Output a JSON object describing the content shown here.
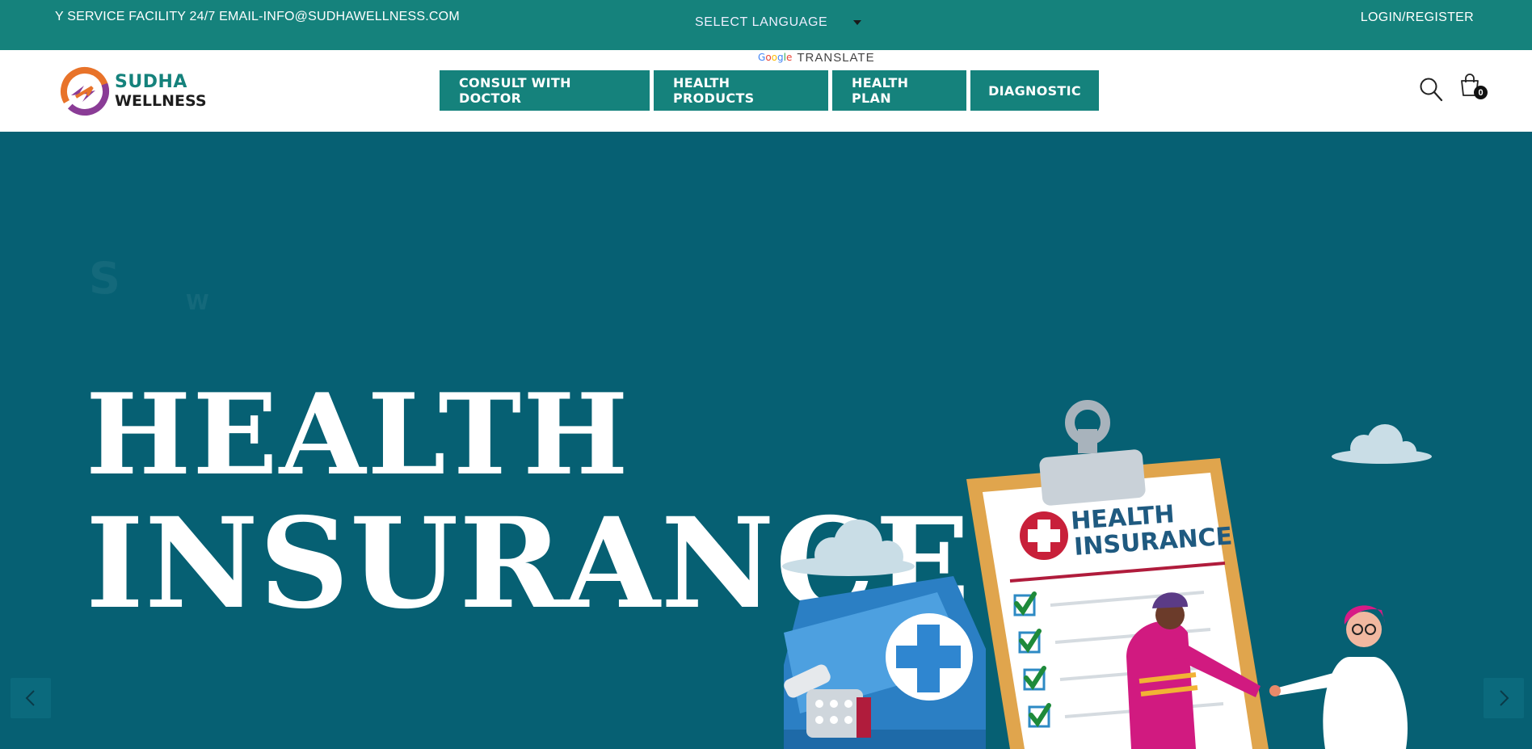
{
  "topbar": {
    "marquee": "Y SERVICE FACILITY 24/7 EMAIL-INFO@SUDHAWELLNESS.COM",
    "language_select": "SELECT LANGUAGE",
    "login": "LOGIN/REGISTER"
  },
  "translate": {
    "google": "Google",
    "label": "TRANSLATE"
  },
  "brand": {
    "name_line1": "SUDHA",
    "name_line2": "WELLNESS"
  },
  "nav": {
    "items": [
      {
        "label": "CONSULT WITH DOCTOR"
      },
      {
        "label": "HEALTH PRODUCTS"
      },
      {
        "label": "HEALTH PLAN"
      },
      {
        "label": "DIAGNOSTIC"
      }
    ]
  },
  "cart": {
    "count": "0"
  },
  "hero": {
    "headline_line1": "HEALTH",
    "headline_line2": "INSURANCE",
    "illustration_text_line1": "HEALTH",
    "illustration_text_line2": "INSURANCE"
  },
  "colors": {
    "primary": "#15827c",
    "hero_bg": "#066073",
    "accent_orange": "#e8732a",
    "accent_purple": "#8a3c96"
  },
  "icons": {
    "search": "search-icon",
    "cart": "cart-icon",
    "prev": "chevron-left-icon",
    "next": "chevron-right-icon",
    "caret": "caret-down-icon"
  }
}
